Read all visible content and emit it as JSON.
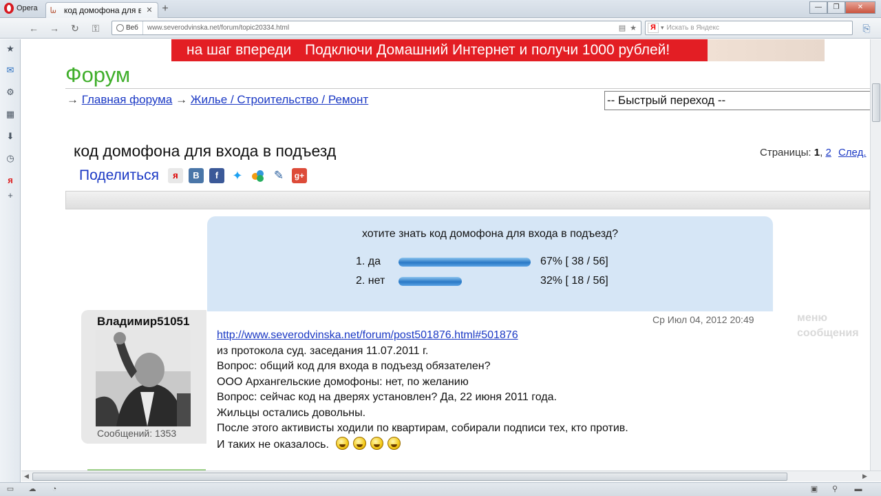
{
  "browser": {
    "menu_label": "Opera",
    "tab_title": "код домофона для вхо...",
    "tab_close": "✕",
    "new_tab": "+",
    "window_buttons": {
      "minimize": "—",
      "maximize": "❐",
      "close": "✕"
    },
    "nav": {
      "back": "←",
      "forward": "→",
      "reload": "↻",
      "key": "⚿"
    },
    "address": {
      "badge": "Веб",
      "url": "www.severodvinska.net/forum/topic20334.html"
    },
    "search": {
      "logo": "Я",
      "placeholder": "Искать в Яндекс"
    }
  },
  "sidebar_icons": [
    "star-icon",
    "mail-icon",
    "gear-icon",
    "notes-icon",
    "download-icon",
    "clock-icon",
    "yandex-icon",
    "plus-icon"
  ],
  "banner": {
    "left_text": "на шаг впереди",
    "right_text": "Подключи Домашний Интернет и получи 1000 рублей!"
  },
  "forum": {
    "title": "Форум",
    "breadcrumb": {
      "arrow": "→",
      "home": "Главная форума",
      "section": "Жилье / Строительство / Ремонт"
    },
    "quick_jump": "-- Быстрый переход --"
  },
  "topic": {
    "title": "код домофона для входа в подъезд",
    "pages": {
      "label": "Страницы:",
      "current": "1",
      "sep": ",",
      "next_page": "2",
      "next": "След."
    }
  },
  "share": {
    "label": "Поделиться",
    "networks": [
      "yandex-share-icon",
      "vk-icon",
      "facebook-icon",
      "twitter-icon",
      "myworld-icon",
      "livejournal-icon",
      "google-plus-icon"
    ]
  },
  "poll": {
    "question": "хотите знать код домофона для входа в подъезд?",
    "options": [
      {
        "label": "1. да",
        "percent": 67,
        "result": "67% [ 38 / 56]"
      },
      {
        "label": "2. нет",
        "percent": 32,
        "result": "32% [ 18 / 56]"
      }
    ]
  },
  "post": {
    "author": "Владимир51051",
    "post_count": "Сообщений: 1353",
    "date": "Ср Июл 04, 2012 20:49",
    "link": "http://www.severodvinska.net/forum/post501876.html#501876",
    "lines": [
      "из протокола суд. заседания 11.07.2011 г.",
      "Вопрос: общий код для входа в подъезд обязателен?",
      "ООО Архангельские домофоны: нет, по желанию",
      "Вопрос: сейчас код на дверях установлен? Да, 22 июня 2011 года.",
      "Жильцы остались довольны.",
      "После этого активисты ходили по квартирам, собирали подписи тех, кто против.",
      "И таких не оказалось."
    ],
    "smileys": 4,
    "menu": [
      "меню",
      "сообщения"
    ]
  }
}
